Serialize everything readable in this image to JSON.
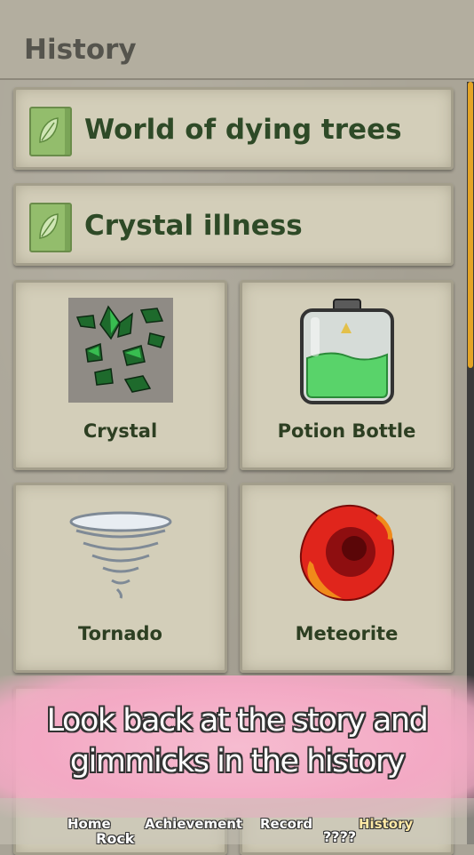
{
  "header": {
    "title": "History"
  },
  "stories": [
    {
      "label": "World of dying trees",
      "icon": "leaf-book-icon"
    },
    {
      "label": "Crystal illness",
      "icon": "leaf-book-icon"
    }
  ],
  "gimmicks": [
    {
      "label": "Crystal",
      "icon": "crystal-icon"
    },
    {
      "label": "Potion Bottle",
      "icon": "potion-bottle-icon"
    },
    {
      "label": "Tornado",
      "icon": "tornado-icon"
    },
    {
      "label": "Meteorite",
      "icon": "meteorite-icon"
    }
  ],
  "partial_cards": [
    "Rock",
    "????"
  ],
  "banner": {
    "line1": "Look back at the story and",
    "line2": "gimmicks in the history"
  },
  "nav": {
    "home": "Home",
    "achievement": "Achievement",
    "record": "Record",
    "history": "History"
  },
  "colors": {
    "accent_scrollbar": "#e4a426",
    "banner_pink": "#f3a9c4",
    "label_green": "#2e4a27"
  }
}
